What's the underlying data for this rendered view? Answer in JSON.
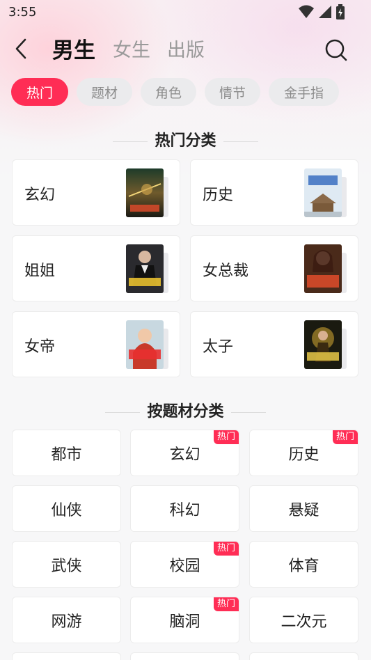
{
  "status": {
    "time": "3:55"
  },
  "header": {
    "tabs": [
      {
        "label": "男生",
        "active": true
      },
      {
        "label": "女生",
        "active": false
      },
      {
        "label": "出版",
        "active": false
      }
    ]
  },
  "chips": [
    {
      "label": "热门",
      "active": true
    },
    {
      "label": "题材",
      "active": false
    },
    {
      "label": "角色",
      "active": false
    },
    {
      "label": "情节",
      "active": false
    },
    {
      "label": "金手指",
      "active": false
    }
  ],
  "hot_section": {
    "title": "热门分类",
    "categories": [
      {
        "label": "玄幻",
        "cover_text": "剑道独尊"
      },
      {
        "label": "历史",
        "cover_text": "假太监"
      },
      {
        "label": "姐姐",
        "cover_text": "天王归来"
      },
      {
        "label": "女总裁",
        "cover_text": "绝色总裁"
      },
      {
        "label": "女帝",
        "cover_text": "开局女帝"
      },
      {
        "label": "太子",
        "cover_text": "天下第一"
      }
    ]
  },
  "topic_section": {
    "title": "按题材分类",
    "badge_label": "热门",
    "topics": [
      {
        "label": "都市",
        "hot": false
      },
      {
        "label": "玄幻",
        "hot": true
      },
      {
        "label": "历史",
        "hot": true
      },
      {
        "label": "仙侠",
        "hot": false
      },
      {
        "label": "科幻",
        "hot": false
      },
      {
        "label": "悬疑",
        "hot": false
      },
      {
        "label": "武侠",
        "hot": false
      },
      {
        "label": "校园",
        "hot": true
      },
      {
        "label": "体育",
        "hot": false
      },
      {
        "label": "网游",
        "hot": false
      },
      {
        "label": "脑洞",
        "hot": true
      },
      {
        "label": "二次元",
        "hot": false
      }
    ]
  },
  "colors": {
    "accent": "#ff2d55",
    "chip_bg": "#ebebed",
    "page_bg": "#f7f7f8"
  }
}
